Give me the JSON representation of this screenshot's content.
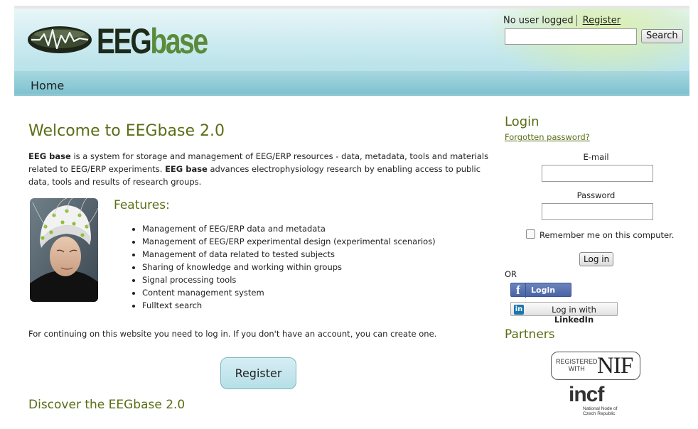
{
  "header": {
    "logo": {
      "part1": "EEG",
      "part2": "base"
    },
    "nav": {
      "home": "Home"
    },
    "user": {
      "status": "No user logged",
      "register": "Register"
    },
    "search": {
      "button": "Search",
      "value": ""
    }
  },
  "main": {
    "title": "Welcome to EEGbase 2.0",
    "intro": {
      "brand1": "EEG base",
      "text1": " is a system for storage and management of EEG/ERP resources - data, metadata, tools and materials related to EEG/ERP experiments. ",
      "brand2": "EEG base",
      "text2": " advances electrophysiology research by enabling access to public data, tools and results of research groups."
    },
    "features_title": "Features:",
    "features": [
      "Management of EEG/ERP data and metadata",
      "Management of EEG/ERP experimental design (experimental scenarios)",
      "Management of data related to tested subjects",
      "Sharing of knowledge and working within groups",
      "Signal processing tools",
      "Content management system",
      "Fulltext search"
    ],
    "continue_text": "For continuing on this website you need to log in. If you don't have an account, you can create one.",
    "register_button": "Register",
    "discover_title": "Discover the EEGbase 2.0"
  },
  "sidebar": {
    "login_title": "Login",
    "forgot": "Forgotten password?",
    "email_label": "E-mail",
    "password_label": "Password",
    "remember": "Remember me on this computer.",
    "login_button": "Log in",
    "or": "OR",
    "facebook_login": "Login",
    "linkedin_prefix": "Log in with ",
    "linkedin_brand": "LinkedIn",
    "partners_title": "Partners",
    "nif": {
      "registered_line1": "REGISTERED",
      "registered_line2": "WITH",
      "name": "NIF"
    },
    "incf": {
      "name": "incf",
      "sub_line1": "National Node of",
      "sub_line2": "Czech Republic"
    }
  },
  "colors": {
    "accent_green": "#5a6e16",
    "header_blue": "#a9dbe3",
    "facebook_blue": "#4a64a4",
    "linkedin_blue": "#1a76b0"
  },
  "icons": [
    "eeg-wave-logo-icon",
    "facebook-icon",
    "linkedin-icon",
    "checkbox-icon"
  ]
}
